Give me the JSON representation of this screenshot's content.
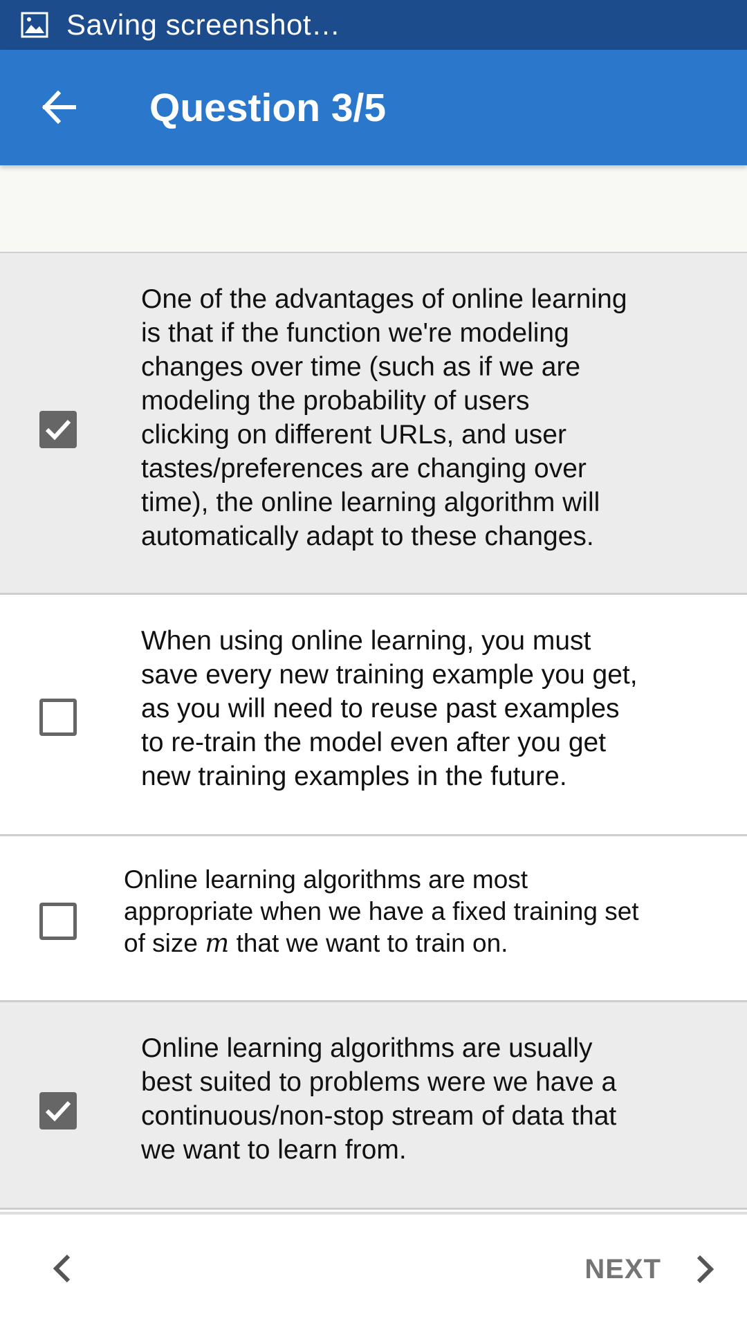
{
  "status_bar": {
    "icon": "image-icon",
    "text": "Saving screenshot…"
  },
  "app_bar": {
    "back_icon": "arrow-left-icon",
    "title": "Question 3/5"
  },
  "options": [
    {
      "checked": true,
      "text": "One of the advantages of online learning\nis that if the function we're modeling\nchanges over time (such as if we are\nmodeling the probability of users\nclicking on different URLs, and user\ntastes/preferences are changing over\ntime), the online learning algorithm will\nautomatically adapt to these changes."
    },
    {
      "checked": false,
      "text": " When using online learning, you must\nsave every new training example you get,\nas you will need to reuse past examples\nto re-train the model even after you get\nnew training examples in the future."
    },
    {
      "checked": false,
      "text_before": "Online learning algorithms are most\nappropriate when we have a fixed training set\nof size ",
      "math": "m",
      "text_after": " that we want to train on."
    },
    {
      "checked": true,
      "text": " Online learning algorithms are usually\nbest suited to problems were we have a\ncontinuous/non-stop stream of data that\nwe want to learn from."
    }
  ],
  "footer": {
    "prev_icon": "chevron-left-icon",
    "next_label": "NEXT",
    "next_icon": "chevron-right-icon"
  },
  "colors": {
    "status_bar": "#1c4c8c",
    "app_bar": "#2a77cc",
    "selected_row": "#ececec",
    "checkbox": "#666666"
  }
}
